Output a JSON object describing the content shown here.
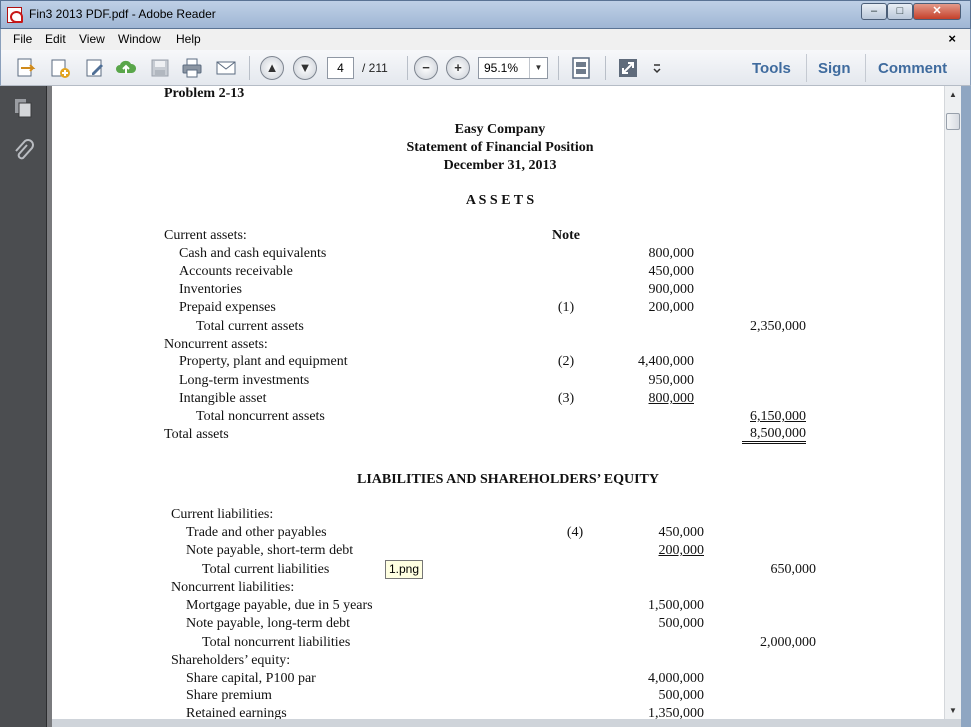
{
  "window": {
    "title": "Fin3 2013 PDF.pdf - Adobe Reader",
    "buttons": {
      "minimize": "–",
      "maximize": "□",
      "close": "✕"
    }
  },
  "menu": {
    "items": [
      "File",
      "Edit",
      "View",
      "Window",
      "Help"
    ],
    "close_doc": "×"
  },
  "toolbar": {
    "page_current": "4",
    "page_total": "/ 211",
    "zoom": "95.1%",
    "tools_label": "Tools",
    "sign_label": "Sign",
    "comment_label": "Comment",
    "accent_color": "#3f6b9e"
  },
  "tooltip": "1.png",
  "statement": {
    "problem": "Problem 2-13",
    "company": "Easy Company",
    "statement_title": "Statement of Financial Position",
    "date": "December 31, 2013",
    "assets_heading": "A S S E T S",
    "note_header": "Note",
    "current_assets_label": "Current assets:",
    "current_assets": [
      {
        "label": "Cash and cash equivalents",
        "note": "",
        "amount": "800,000"
      },
      {
        "label": "Accounts receivable",
        "note": "",
        "amount": "450,000"
      },
      {
        "label": "Inventories",
        "note": "",
        "amount": "900,000"
      },
      {
        "label": "Prepaid expenses",
        "note": "(1)",
        "amount": "200,000"
      }
    ],
    "total_current_assets_label": "Total current assets",
    "total_current_assets": "2,350,000",
    "noncurrent_assets_label": "Noncurrent assets:",
    "noncurrent_assets": [
      {
        "label": "Property, plant and equipment",
        "note": "(2)",
        "amount": "4,400,000"
      },
      {
        "label": "Long-term investments",
        "note": "",
        "amount": "950,000"
      },
      {
        "label": "Intangible asset",
        "note": "(3)",
        "amount": "800,000"
      }
    ],
    "total_noncurrent_assets_label": "Total noncurrent assets",
    "total_noncurrent_assets": "6,150,000",
    "total_assets_label": "Total assets",
    "total_assets": "8,500,000",
    "liabilities_heading": "LIABILITIES AND SHAREHOLDERS’ EQUITY",
    "current_liabilities_label": "Current liabilities:",
    "current_liabilities": [
      {
        "label": "Trade and other payables",
        "note": "(4)",
        "amount": "450,000"
      },
      {
        "label": "Note payable, short-term debt",
        "note": "",
        "amount": "200,000"
      }
    ],
    "total_current_liabilities_label": "Total current liabilities",
    "total_current_liabilities": "650,000",
    "noncurrent_liabilities_label": "Noncurrent liabilities:",
    "noncurrent_liabilities": [
      {
        "label": "Mortgage payable, due in 5 years",
        "amount": "1,500,000"
      },
      {
        "label": "Note payable, long-term debt",
        "amount": "500,000"
      }
    ],
    "total_noncurrent_liabilities_label": "Total noncurrent liabilities",
    "total_noncurrent_liabilities": "2,000,000",
    "equity_label": "Shareholders’ equity:",
    "equity": [
      {
        "label": "Share capital, P100 par",
        "amount": "4,000,000"
      },
      {
        "label": "Share premium",
        "amount": "500,000"
      },
      {
        "label": "Retained earnings",
        "amount": "1,350,000"
      }
    ]
  }
}
